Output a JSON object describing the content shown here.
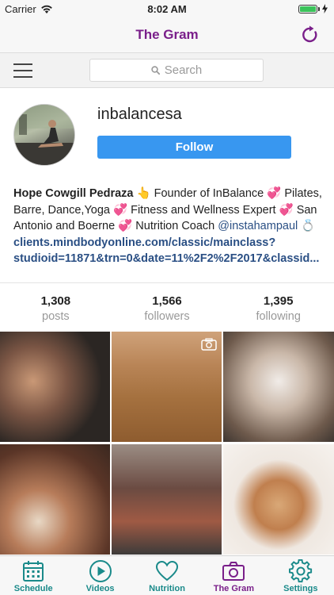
{
  "status_bar": {
    "carrier": "Carrier",
    "time": "8:02 AM"
  },
  "nav": {
    "title": "The Gram"
  },
  "search": {
    "placeholder": "Search"
  },
  "profile": {
    "username": "inbalancesa",
    "follow_label": "Follow",
    "bio_name": "Hope Cowgill Pedraza",
    "bio_text": " 👆 Founder of InBalance 💞 Pilates, Barre, Dance,Yoga 💞 Fitness and Wellness Expert 💞 San Antonio and Boerne 💞 Nutrition Coach ",
    "bio_mention": "@instahampaul",
    "bio_ring": " 💍",
    "bio_link_1": "clients.mindbodyonline.com/classic/mainclass?",
    "bio_link_2": "studioid=11871&trn=0&date=11%2F2%2F2017&classid..."
  },
  "stats": [
    {
      "value": "1,308",
      "label": "posts"
    },
    {
      "value": "1,566",
      "label": "followers"
    },
    {
      "value": "1,395",
      "label": "following"
    }
  ],
  "tabs": [
    {
      "label": "Schedule",
      "icon": "calendar-icon"
    },
    {
      "label": "Videos",
      "icon": "play-icon"
    },
    {
      "label": "Nutrition",
      "icon": "heart-icon"
    },
    {
      "label": "The Gram",
      "icon": "camera-icon"
    },
    {
      "label": "Settings",
      "icon": "gear-icon"
    }
  ],
  "colors": {
    "title_purple": "#7a1f8a",
    "follow_blue": "#3897f0",
    "tab_teal": "#1a8a8a",
    "link_blue": "#2a4f84"
  }
}
